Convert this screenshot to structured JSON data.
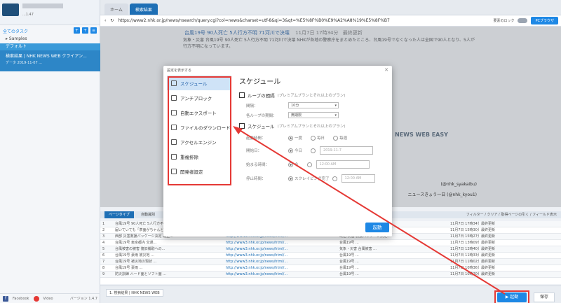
{
  "left_panel": {
    "app_sub": "...1.47",
    "badge": "",
    "section_title": "全てのタスク",
    "folder": "Samples",
    "default_folder": "デフォルト",
    "task_title": "検索結果 | NHK NEWS WEB クライアン...",
    "task_sub": "データ 2019-11-07 ...",
    "facebook": "Facebook",
    "video": "Video",
    "version": "バージョン 1.4.7"
  },
  "browser": {
    "tabs": [
      "ホーム",
      "検索結果"
    ],
    "url": "https://www2.nhk.or.jp/news/nsearch/query.cgi?col=news&charset=utf-8&qi=3&qt=%E5%8F%B0%E9%A2%A8%19%E5%8F%B7",
    "toolbar_label": "要素のロック",
    "pc_browser": "PCブラウザ",
    "article_title": "台風19号 90人死亡 5人行方不明 71河川で決壊",
    "article_date": "11月7日 17時34分",
    "article_more": "最終更新",
    "article_text": "気象・災害 台風19号 90人死亡 5人行方不明 71河川で決壊 NHKが各地の警察庁をまとめたところ、台風19号でなくなった人は全国で90人となり、5人が行方不明になっています。",
    "banner": "NEWS WEB EASY",
    "side_text": "ニュースきょう一日 (@nhk_kyou1)",
    "side_text2": "(@nhk_syakaibu)"
  },
  "grid": {
    "tabs": [
      "ページタイプ",
      "自動識別"
    ],
    "toolbar_right": "フィルター / クリア / 取得ページの引く / フィールド表示",
    "header": [
      "",
      "タイトル",
      "",
      "",
      "",
      ""
    ],
    "rows": [
      [
        "1",
        "台風19号 90人死亡 5人行方不明 71河川で決壊",
        "http://www3.nhk.or.jp/news/html/...",
        "気象・災害 台風19号 90人死亡...",
        "11月7日 17時34分",
        "最終更新"
      ],
      [
        "2",
        "届いていても「表面がちゃんと」台風被害...",
        "http://www3.nhk.or.jp/news/html/...",
        "災害情報メールの課題 ...",
        "11月7日 15時30分",
        "最終更新"
      ],
      [
        "3",
        "西部 災害救援パッケージ決定 補正...",
        "http://www3.nhk.or.jp/news/html/...",
        "政治 災害 救援パッケージ決定...",
        "11月7日 15時27分",
        "最終更新"
      ],
      [
        "4",
        "台風19号 東京都内 交通...",
        "http://www3.nhk.or.jp/news/html/...",
        "台風19号 ...",
        "11月7日 13時09分",
        "最終更新"
      ],
      [
        "5",
        "台風被害の被害 復旧補助への...",
        "http://www3.nhk.or.jp/news/html/...",
        "気象・災害 台風被害 ...",
        "11月7日 12時40分",
        "最終更新"
      ],
      [
        "6",
        "台風19号 豪雨 被災地 ...",
        "http://www3.nhk.or.jp/news/html/...",
        "台風19号 ...",
        "11月7日 11時33分",
        "最終更新"
      ],
      [
        "7",
        "台風19号 被災地の現状 ...",
        "http://www3.nhk.or.jp/news/html/...",
        "台風19号 ...",
        "11月7日 11時02分",
        "最終更新"
      ],
      [
        "8",
        "台風19号 豪雨 ...",
        "http://www3.nhk.or.jp/news/html/...",
        "台風19号 ...",
        "11月7日 10時36分",
        "最終更新"
      ],
      [
        "9",
        "防災訓練 ハード面とソフト面 ...",
        "http://www3.nhk.or.jp/news/html/...",
        "台風19号 ...",
        "11月7日 10時20分",
        "最終更新"
      ]
    ]
  },
  "footer": {
    "task_tab": "1. 検索結果 | NHK NEWS WEB",
    "start_label": "▶ 起動",
    "stop_label": "保存"
  },
  "modal": {
    "header": "設定を表示する",
    "nav": [
      {
        "label": "スケジュール",
        "icon": "alarm-icon"
      },
      {
        "label": "アンチブロック",
        "icon": "shield-icon"
      },
      {
        "label": "自動エクスポート",
        "icon": "export-icon"
      },
      {
        "label": "ファイルのダウンロード",
        "icon": "file-icon"
      },
      {
        "label": "アクセルエンジン",
        "icon": "engine-icon"
      },
      {
        "label": "重複排除",
        "icon": "dedupe-icon"
      },
      {
        "label": "開発者設定",
        "icon": "gear-icon"
      }
    ],
    "title": "スケジュール",
    "loop_label": "ループの間隔",
    "loop_hint": "(プレミアムプランとそれ以上のプラン)",
    "interval_label": "間隔：",
    "interval_value": "10分",
    "loop_period_label": "各ループの期間：",
    "loop_period_value": "無期限",
    "schedule_label": "スケジュール",
    "schedule_hint": "(プレミアムプランとそれ以上のプラン)",
    "start_label": "起動時間：",
    "options": [
      "一度",
      "毎日",
      "毎週"
    ],
    "start_date_label": "開始日：",
    "start_date_opt": "今日",
    "start_date_value": "2019-11-7",
    "begin_time_label": "始まる時間：",
    "begin_time_opt": "今",
    "begin_time_value": "12:00 AM",
    "stop_time_label": "停止時間：",
    "stop_time_opt": "スクレイピング完了",
    "stop_time_value": "12:00 AM",
    "run_label": "起動"
  },
  "colors": {
    "accent": "#1e88e5",
    "highlight": "#e53935"
  }
}
